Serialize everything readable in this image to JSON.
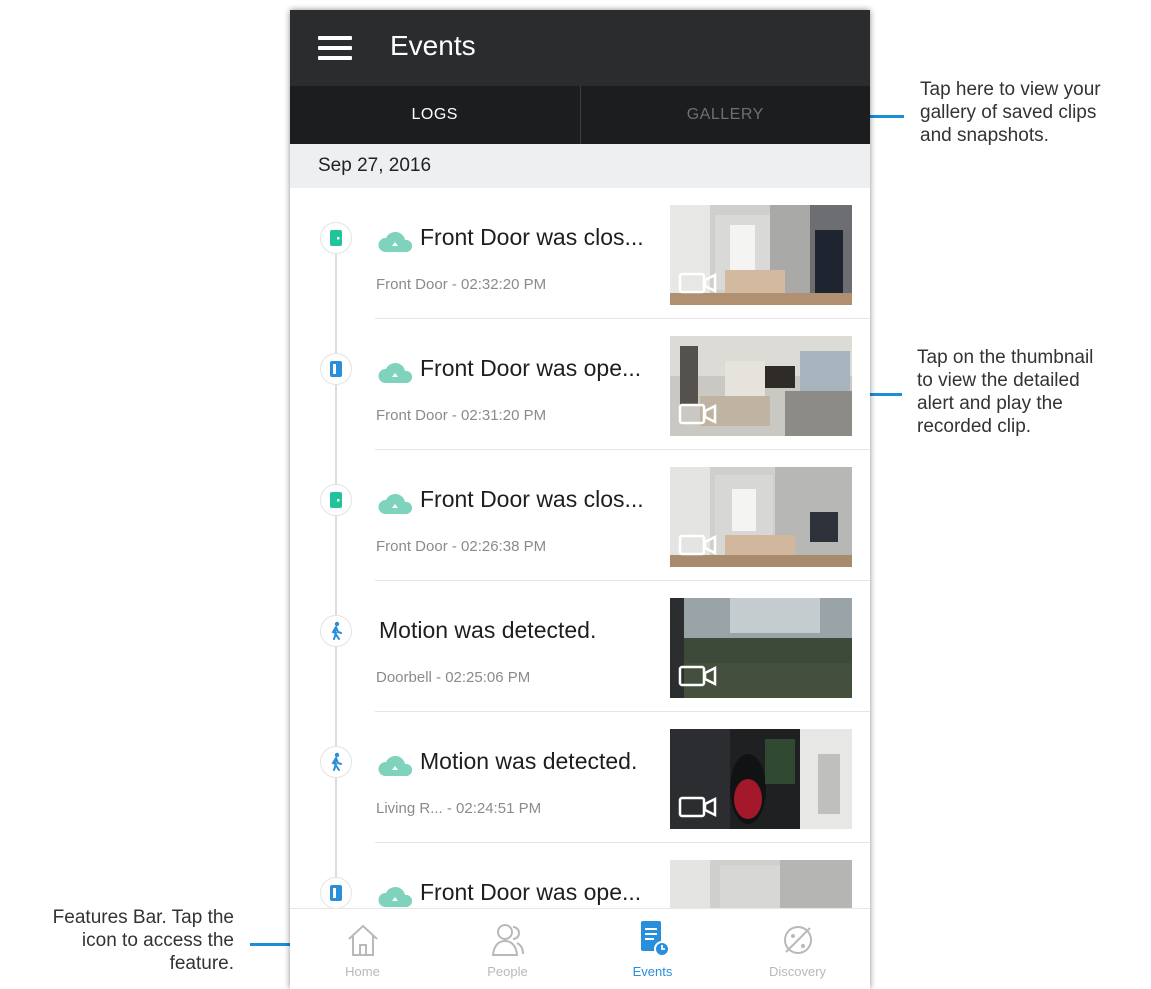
{
  "app": {
    "title": "Events",
    "menu_icon": "hamburger-menu-icon"
  },
  "tabs": [
    {
      "label": "LOGS",
      "active": true
    },
    {
      "label": "GALLERY",
      "active": false
    }
  ],
  "date_header": "Sep 27, 2016",
  "events": [
    {
      "icon": "door-closed-icon",
      "cloud": true,
      "title": "Front Door was clos...",
      "subtitle": "Front Door - 02:32:20 PM",
      "icon_color": "#22c29a"
    },
    {
      "icon": "door-open-icon",
      "cloud": true,
      "title": "Front Door was ope...",
      "subtitle": "Front Door - 02:31:20 PM",
      "icon_color": "#2a8fdb"
    },
    {
      "icon": "door-closed-icon",
      "cloud": true,
      "title": "Front Door was clos...",
      "subtitle": "Front Door - 02:26:38 PM",
      "icon_color": "#22c29a"
    },
    {
      "icon": "motion-icon",
      "cloud": false,
      "title": "Motion was detected.",
      "subtitle": "Doorbell - 02:25:06 PM",
      "icon_color": "#2a8fdb"
    },
    {
      "icon": "motion-icon",
      "cloud": true,
      "title": "Motion was detected.",
      "subtitle": "Living R... - 02:24:51 PM",
      "icon_color": "#2a8fdb"
    },
    {
      "icon": "door-open-icon",
      "cloud": true,
      "title": "Front Door was ope...",
      "subtitle": "",
      "icon_color": "#2a8fdb"
    }
  ],
  "bottom_nav": [
    {
      "label": "Home",
      "icon": "home-icon",
      "active": false
    },
    {
      "label": "People",
      "icon": "people-icon",
      "active": false
    },
    {
      "label": "Events",
      "icon": "events-icon",
      "active": true
    },
    {
      "label": "Discovery",
      "icon": "discovery-icon",
      "active": false
    }
  ],
  "annotations": {
    "gallery": [
      "Tap here to view your",
      "gallery of saved clips",
      "and snapshots."
    ],
    "thumbnail": [
      "Tap on the thumbnail",
      "to view the detailed",
      "alert and play the",
      "recorded clip."
    ],
    "features": [
      "Features Bar. Tap the",
      "icon to access the",
      "feature."
    ]
  },
  "colors": {
    "appbar": "#2a2c2e",
    "tabbar": "#1c1d1e",
    "accent_blue": "#2a8fdb",
    "accent_green": "#22c29a",
    "cloud": "#7fd3bd",
    "leader_line": "#1a8ed6"
  }
}
